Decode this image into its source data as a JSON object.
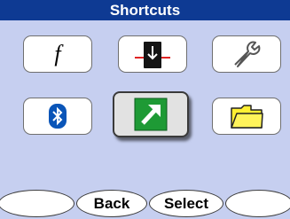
{
  "header": {
    "title": "Shortcuts"
  },
  "shortcuts": [
    {
      "icon": "function-icon",
      "glyph": "f"
    },
    {
      "icon": "bookmark-download-icon"
    },
    {
      "icon": "wrench-icon"
    },
    {
      "icon": "bluetooth-icon"
    },
    {
      "icon": "green-arrow-icon"
    },
    {
      "icon": "folder-icon"
    }
  ],
  "softkeys": {
    "left": "",
    "back": "Back",
    "select": "Select",
    "right": ""
  },
  "colors": {
    "title_bar": "#0e3a93",
    "background": "#c6cff0",
    "bluetooth": "#0a55b8",
    "green": "#1e9a35",
    "folder": "#ffef33"
  }
}
